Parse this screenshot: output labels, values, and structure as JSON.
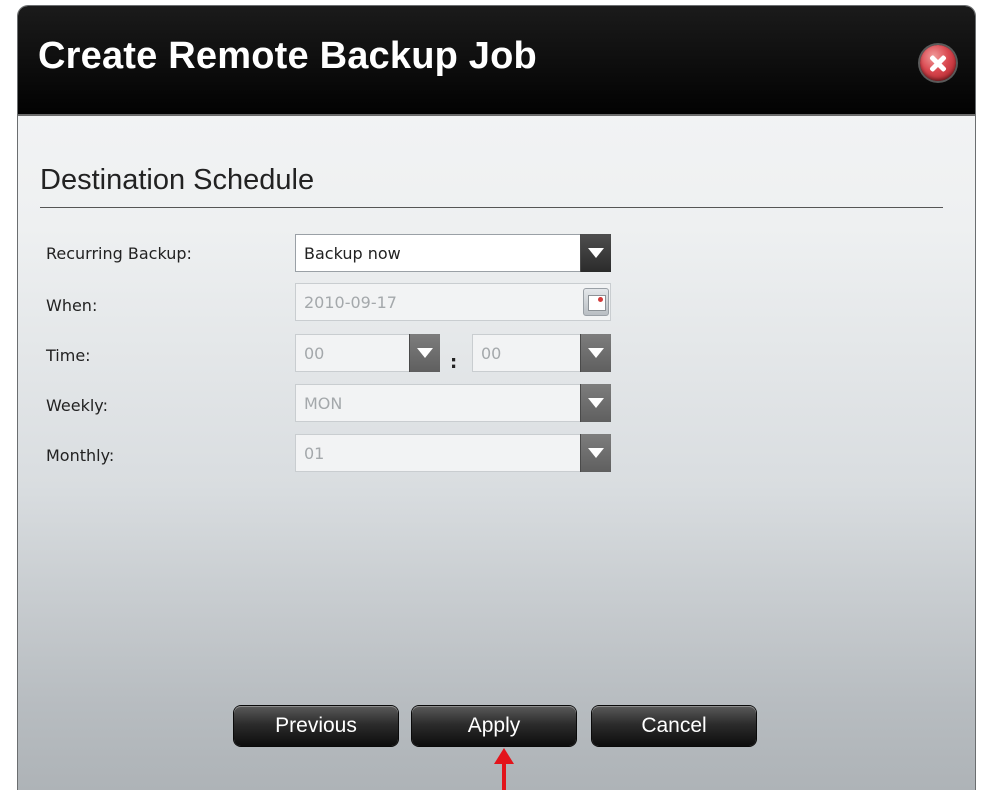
{
  "dialog": {
    "title": "Create Remote Backup Job",
    "close_icon": "close-icon"
  },
  "section": {
    "title": "Destination Schedule"
  },
  "form": {
    "recurring": {
      "label": "Recurring Backup:",
      "value": "Backup now"
    },
    "when": {
      "label": "When:",
      "value": "2010-09-17",
      "icon": "calendar-icon"
    },
    "time": {
      "label": "Time:",
      "hour": "00",
      "separator": ":",
      "minute": "00"
    },
    "weekly": {
      "label": "Weekly:",
      "value": "MON"
    },
    "monthly": {
      "label": "Monthly:",
      "value": "01"
    }
  },
  "buttons": {
    "previous": "Previous",
    "apply": "Apply",
    "cancel": "Cancel"
  },
  "colors": {
    "titlebar": "#000000",
    "annotation_arrow": "#e3141b"
  }
}
